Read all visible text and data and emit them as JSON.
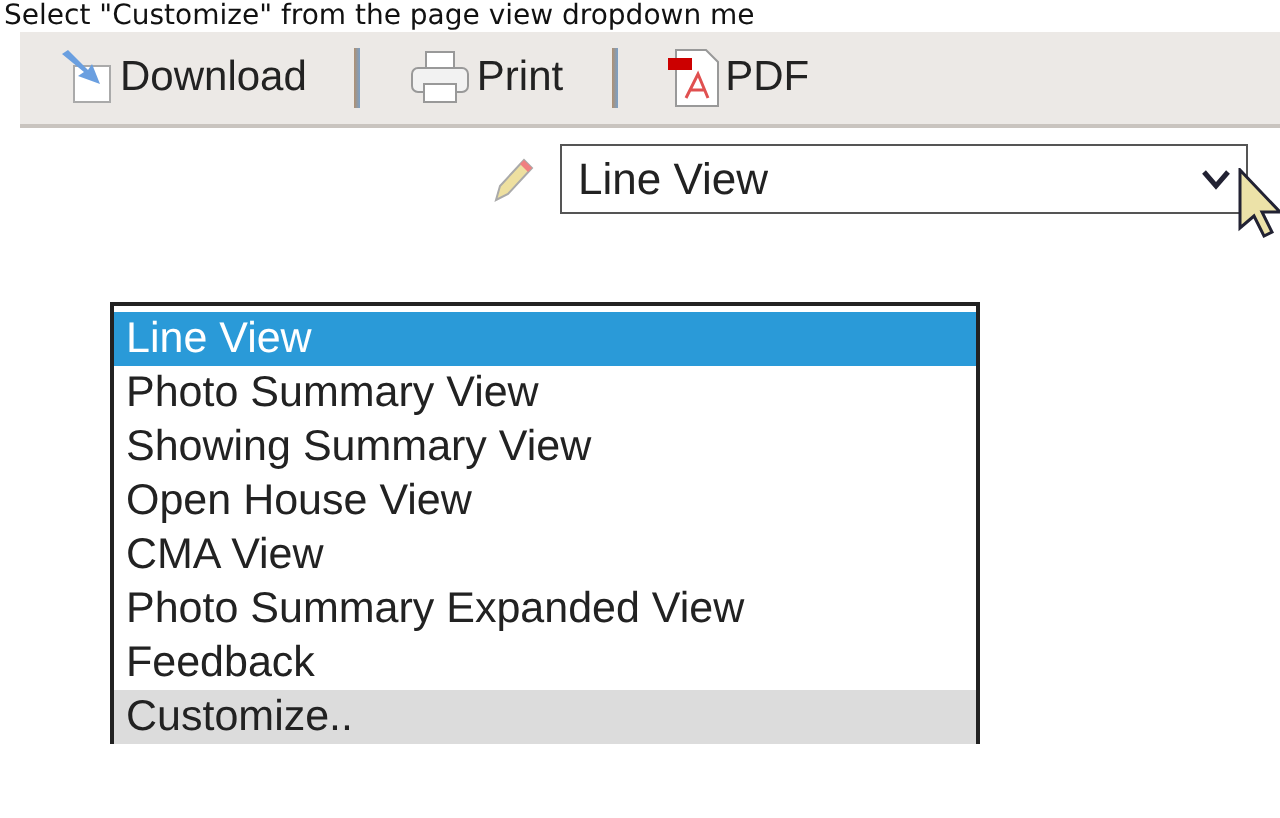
{
  "caption": "Select \"Customize\" from the page view dropdown me",
  "toolbar": {
    "buttons": [
      {
        "kind": "download",
        "label": "Download"
      },
      {
        "kind": "print",
        "label": "Print"
      },
      {
        "kind": "pdf",
        "label": "PDF"
      }
    ]
  },
  "view_select": {
    "value": "Line View",
    "open": true
  },
  "view_options": [
    {
      "label": "Line View",
      "selected": true,
      "hovered": false
    },
    {
      "label": "Photo Summary View",
      "selected": false,
      "hovered": false
    },
    {
      "label": "Showing Summary View",
      "selected": false,
      "hovered": false
    },
    {
      "label": "Open House View",
      "selected": false,
      "hovered": false
    },
    {
      "label": "CMA View",
      "selected": false,
      "hovered": false
    },
    {
      "label": "Photo Summary Expanded View",
      "selected": false,
      "hovered": false
    },
    {
      "label": "Feedback",
      "selected": false,
      "hovered": false
    },
    {
      "label": "Customize..",
      "selected": false,
      "hovered": true
    }
  ]
}
